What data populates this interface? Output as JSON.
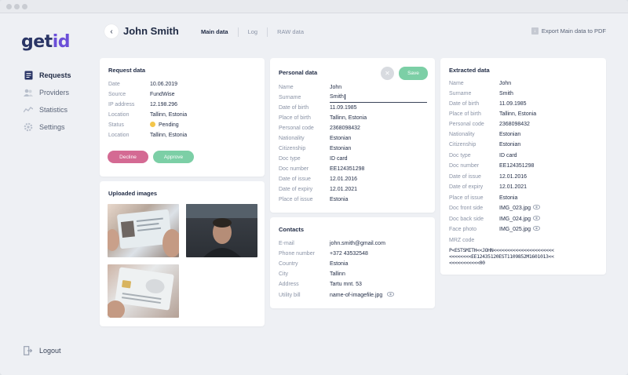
{
  "app": {
    "logo_main": "get",
    "logo_accent": "id"
  },
  "sidebar": {
    "items": [
      {
        "label": "Requests",
        "icon": "requests-icon"
      },
      {
        "label": "Providers",
        "icon": "providers-icon"
      },
      {
        "label": "Statistics",
        "icon": "statistics-icon"
      },
      {
        "label": "Settings",
        "icon": "settings-icon"
      }
    ],
    "logout": "Logout"
  },
  "header": {
    "title": "John Smith",
    "tabs": [
      "Main data",
      "Log",
      "RAW data"
    ],
    "export": "Export Main data to PDF"
  },
  "request": {
    "title": "Request data",
    "rows": [
      {
        "k": "Date",
        "v": "10.06.2019"
      },
      {
        "k": "Source",
        "v": "FundWise"
      },
      {
        "k": "IP address",
        "v": "12.198.296"
      },
      {
        "k": "Location",
        "v": "Tallinn, Estonia"
      },
      {
        "k": "Status",
        "v": "Pending"
      },
      {
        "k": "Location",
        "v": "Tallinn, Estonia"
      }
    ],
    "decline": "Decline",
    "approve": "Approve"
  },
  "uploaded": {
    "title": "Uploaded images"
  },
  "personal": {
    "title": "Personal data",
    "save": "Save",
    "cancel_icon": "close-icon",
    "rows": [
      {
        "k": "Name",
        "v": "John"
      },
      {
        "k": "Surname",
        "v": "Smith"
      },
      {
        "k": "Date of birth",
        "v": "11.09.1985"
      },
      {
        "k": "Place of birth",
        "v": "Tallinn, Estonia"
      },
      {
        "k": "Personal code",
        "v": "2368098432"
      },
      {
        "k": "Nationality",
        "v": "Estonian"
      },
      {
        "k": "Citizenship",
        "v": "Estonian"
      },
      {
        "k": "Doc type",
        "v": "ID card"
      },
      {
        "k": "Doc number",
        "v": "EE124351298"
      },
      {
        "k": "Date of issue",
        "v": "12.01.2016"
      },
      {
        "k": "Date of expiry",
        "v": "12.01.2021"
      },
      {
        "k": "Place of issue",
        "v": "Estonia"
      }
    ]
  },
  "contacts": {
    "title": "Contacts",
    "rows": [
      {
        "k": "E-mail",
        "v": "john.smith@gmail.com"
      },
      {
        "k": "Phone number",
        "v": "+372 43532548"
      },
      {
        "k": "Country",
        "v": "Estonia"
      },
      {
        "k": "City",
        "v": "Tallinn"
      },
      {
        "k": "Address",
        "v": "Tartu mnt. 53"
      },
      {
        "k": "Utility bill",
        "v": "name-of-imagefile.jpg"
      }
    ]
  },
  "extracted": {
    "title": "Extracted data",
    "rows": [
      {
        "k": "Name",
        "v": "John"
      },
      {
        "k": "Surname",
        "v": "Smith"
      },
      {
        "k": "Date of birth",
        "v": "11.09.1985"
      },
      {
        "k": "Place of birth",
        "v": "Tallinn, Estonia"
      },
      {
        "k": "Personal code",
        "v": "2368098432"
      },
      {
        "k": "Nationality",
        "v": "Estonian"
      },
      {
        "k": "Citizenship",
        "v": "Estonian"
      },
      {
        "k": "Doc type",
        "v": "ID card"
      },
      {
        "k": "Doc number",
        "v": "EE124351298"
      },
      {
        "k": "Date of issue",
        "v": "12.01.2016"
      },
      {
        "k": "Date of expiry",
        "v": "12.01.2021"
      },
      {
        "k": "Place of issue",
        "v": "Estonia"
      },
      {
        "k": "Doc front side",
        "v": "IMG_023.jpg"
      },
      {
        "k": "Doc back side",
        "v": "IMG_024.jpg"
      },
      {
        "k": "Face photo",
        "v": "IMG_025.jpg"
      },
      {
        "k": "MRZ code",
        "v": ""
      }
    ],
    "mrz": [
      "P<ESTSMITH<<JOHN<<<<<<<<<<<<<<<<<<<<<<",
      "<<<<<<<<EE12435120EST1109852M1601013<<",
      "<<<<<<<<<<<00"
    ]
  },
  "colors": {
    "accent": "#6b4fd8",
    "decline": "#d46a93",
    "approve": "#7ccfa6",
    "pending": "#f3c64b"
  }
}
